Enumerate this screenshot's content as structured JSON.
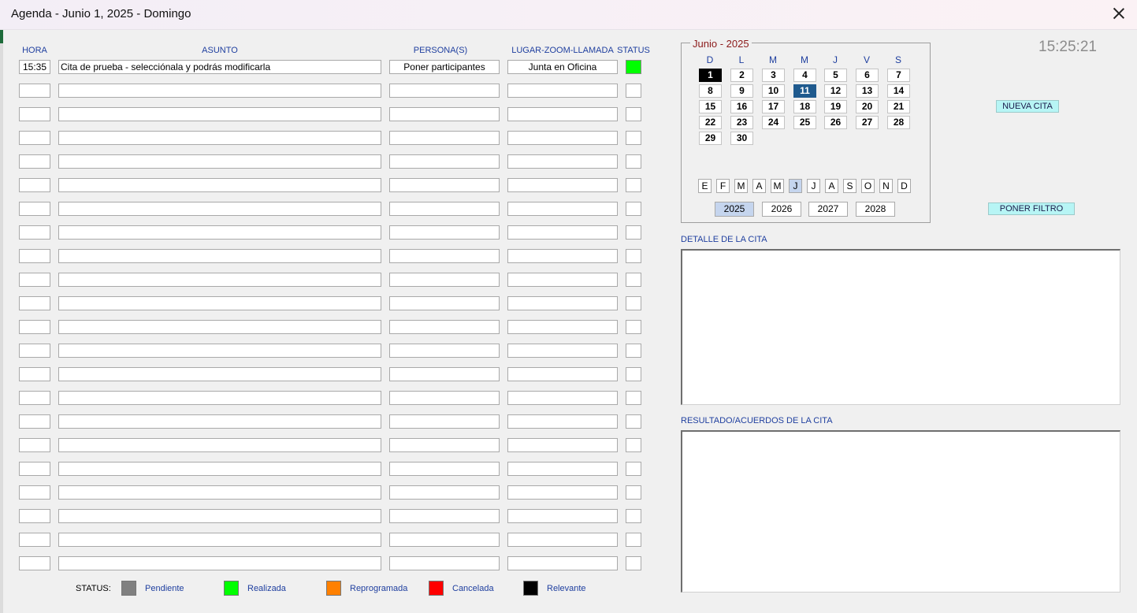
{
  "window": {
    "title": "Agenda - Junio 1, 2025 - Domingo"
  },
  "columns": {
    "hora": "HORA",
    "asunto": "ASUNTO",
    "personas": "PERSONA(S)",
    "lugar": "LUGAR-ZOOM-LLAMADA",
    "status": "STATUS"
  },
  "rows": [
    {
      "hora": "15:35",
      "asunto": "Cita de prueba - selecciónala y podrás modificarla",
      "personas": "Poner participantes",
      "lugar": "Junta en Oficina",
      "status_color": "#00ff00"
    },
    {
      "hora": "",
      "asunto": "",
      "personas": "",
      "lugar": "",
      "status_color": ""
    },
    {
      "hora": "",
      "asunto": "",
      "personas": "",
      "lugar": "",
      "status_color": ""
    },
    {
      "hora": "",
      "asunto": "",
      "personas": "",
      "lugar": "",
      "status_color": ""
    },
    {
      "hora": "",
      "asunto": "",
      "personas": "",
      "lugar": "",
      "status_color": ""
    },
    {
      "hora": "",
      "asunto": "",
      "personas": "",
      "lugar": "",
      "status_color": ""
    },
    {
      "hora": "",
      "asunto": "",
      "personas": "",
      "lugar": "",
      "status_color": ""
    },
    {
      "hora": "",
      "asunto": "",
      "personas": "",
      "lugar": "",
      "status_color": ""
    },
    {
      "hora": "",
      "asunto": "",
      "personas": "",
      "lugar": "",
      "status_color": ""
    },
    {
      "hora": "",
      "asunto": "",
      "personas": "",
      "lugar": "",
      "status_color": ""
    },
    {
      "hora": "",
      "asunto": "",
      "personas": "",
      "lugar": "",
      "status_color": ""
    },
    {
      "hora": "",
      "asunto": "",
      "personas": "",
      "lugar": "",
      "status_color": ""
    },
    {
      "hora": "",
      "asunto": "",
      "personas": "",
      "lugar": "",
      "status_color": ""
    },
    {
      "hora": "",
      "asunto": "",
      "personas": "",
      "lugar": "",
      "status_color": ""
    },
    {
      "hora": "",
      "asunto": "",
      "personas": "",
      "lugar": "",
      "status_color": ""
    },
    {
      "hora": "",
      "asunto": "",
      "personas": "",
      "lugar": "",
      "status_color": ""
    },
    {
      "hora": "",
      "asunto": "",
      "personas": "",
      "lugar": "",
      "status_color": ""
    },
    {
      "hora": "",
      "asunto": "",
      "personas": "",
      "lugar": "",
      "status_color": ""
    },
    {
      "hora": "",
      "asunto": "",
      "personas": "",
      "lugar": "",
      "status_color": ""
    },
    {
      "hora": "",
      "asunto": "",
      "personas": "",
      "lugar": "",
      "status_color": ""
    },
    {
      "hora": "",
      "asunto": "",
      "personas": "",
      "lugar": "",
      "status_color": ""
    },
    {
      "hora": "",
      "asunto": "",
      "personas": "",
      "lugar": "",
      "status_color": ""
    }
  ],
  "legend": {
    "label": "STATUS:",
    "items": [
      {
        "label": "Pendiente",
        "color": "#808080"
      },
      {
        "label": "Realizada",
        "color": "#00ff00"
      },
      {
        "label": "Reprogramada",
        "color": "#ff8000"
      },
      {
        "label": "Cancelada",
        "color": "#ff0000"
      },
      {
        "label": "Relevante",
        "color": "#000000"
      }
    ]
  },
  "calendar": {
    "title": "Junio - 2025",
    "weekdays": [
      "D",
      "L",
      "M",
      "M",
      "J",
      "V",
      "S"
    ],
    "days": [
      "1",
      "2",
      "3",
      "4",
      "5",
      "6",
      "7",
      "8",
      "9",
      "10",
      "11",
      "12",
      "13",
      "14",
      "15",
      "16",
      "17",
      "18",
      "19",
      "20",
      "21",
      "22",
      "23",
      "24",
      "25",
      "26",
      "27",
      "28",
      "29",
      "30"
    ],
    "selected_day": "1",
    "today": "11",
    "months": [
      "E",
      "F",
      "M",
      "A",
      "M",
      "J",
      "J",
      "A",
      "S",
      "O",
      "N",
      "D"
    ],
    "selected_month_index": 5,
    "years": [
      "2025",
      "2026",
      "2027",
      "2028"
    ],
    "selected_year": "2025"
  },
  "clock": "15:25:21",
  "buttons": {
    "nueva_cita": "NUEVA CITA",
    "poner_filtro": "PONER FILTRO"
  },
  "detail": {
    "label": "DETALLE DE LA CITA",
    "value": ""
  },
  "result": {
    "label": "RESULTADO/ACUERDOS DE LA CITA",
    "value": ""
  }
}
